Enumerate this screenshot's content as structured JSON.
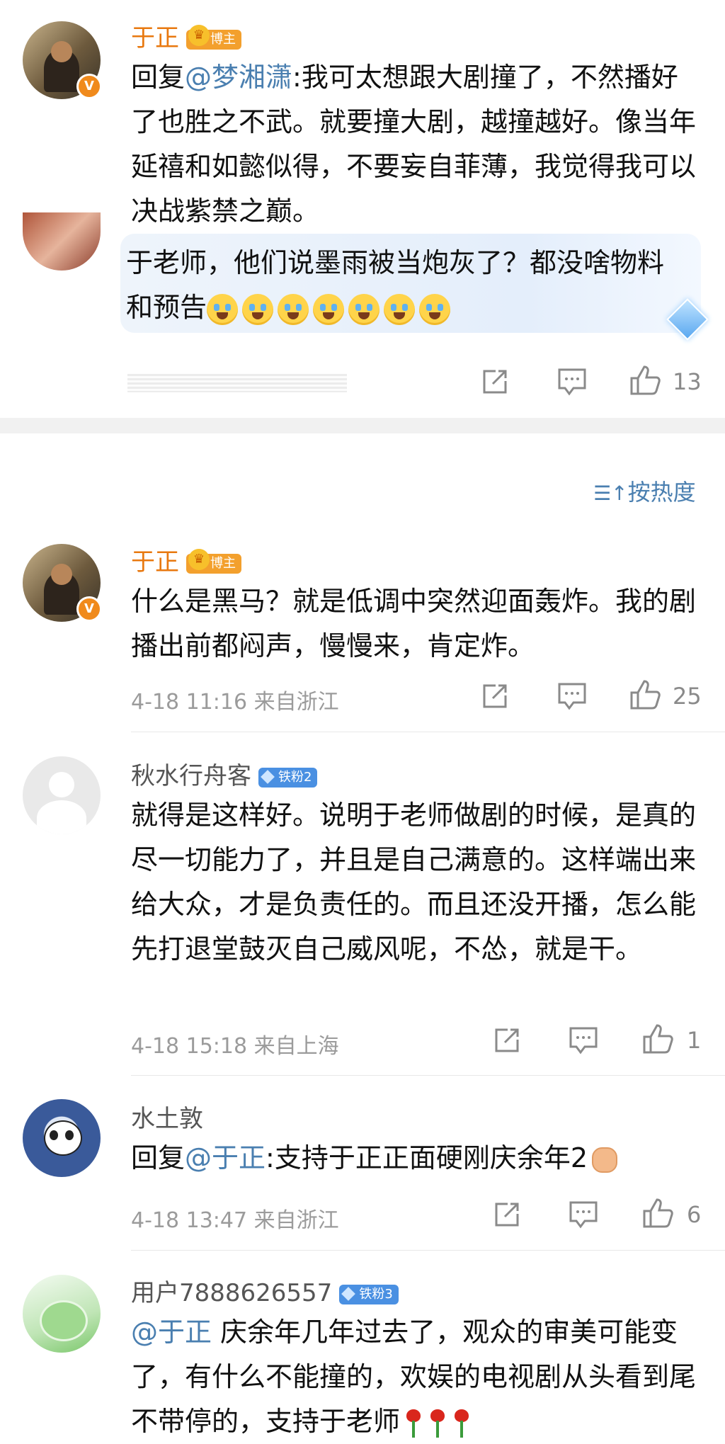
{
  "reply_block": {
    "author": "于正",
    "author_tag": "博主",
    "text_prefix": "回复",
    "mention": "@梦湘潇",
    "text": ":我可太想跟大剧撞了，不然播好了也胜之不武。就要撞大剧，越撞越好。像当年延禧和如懿似得，不要妄自菲薄，我觉得我可以决战紫禁之巅。"
  },
  "highlight_comment": {
    "text": "于老师，他们说墨雨被当炮灰了？都没啥物料和预告",
    "emoji_count": 7,
    "like_count": "13"
  },
  "sort": {
    "icon": "sort-icon",
    "label": "按热度"
  },
  "comments": [
    {
      "author": "于正",
      "author_tag": "博主",
      "text": "什么是黑马？就是低调中突然迎面轰炸。我的剧播出前都闷声，慢慢来，肯定炸。",
      "time": "4-18 11:16",
      "location": "来自浙江",
      "likes": "25"
    },
    {
      "author": "秋水行舟客",
      "fan_tag": "铁粉2",
      "text": "就得是这样好。说明于老师做剧的时候，是真的尽一切能力了，并且是自己满意的。这样端出来给大众，才是负责任的。而且还没开播，怎么能先打退堂鼓灭自己威风呢，不怂，就是干。",
      "time": "4-18 15:18",
      "location": "来自上海",
      "likes": "1"
    },
    {
      "author": "水土敦",
      "text_prefix": "回复",
      "mention": "@于正",
      "text": ":支持于正正面硬刚庆余年2",
      "time": "4-18 13:47",
      "location": "来自浙江",
      "likes": "6"
    },
    {
      "author": "用户7888626557",
      "fan_tag": "铁粉3",
      "mention": "@于正",
      "text": " 庆余年几年过去了，观众的审美可能变了，有什么不能撞的，欢娱的电视剧从头看到尾不带停的，支持于老师"
    }
  ],
  "icons": {
    "share": "share-icon",
    "comment": "comment-icon",
    "like": "like-icon",
    "verified": "verified-badge-icon"
  },
  "colors": {
    "blogger_name": "#e8780f",
    "mention": "#4a7fb0",
    "fan_tag": "#4a90e2",
    "host_tag": "#f3a02d"
  }
}
